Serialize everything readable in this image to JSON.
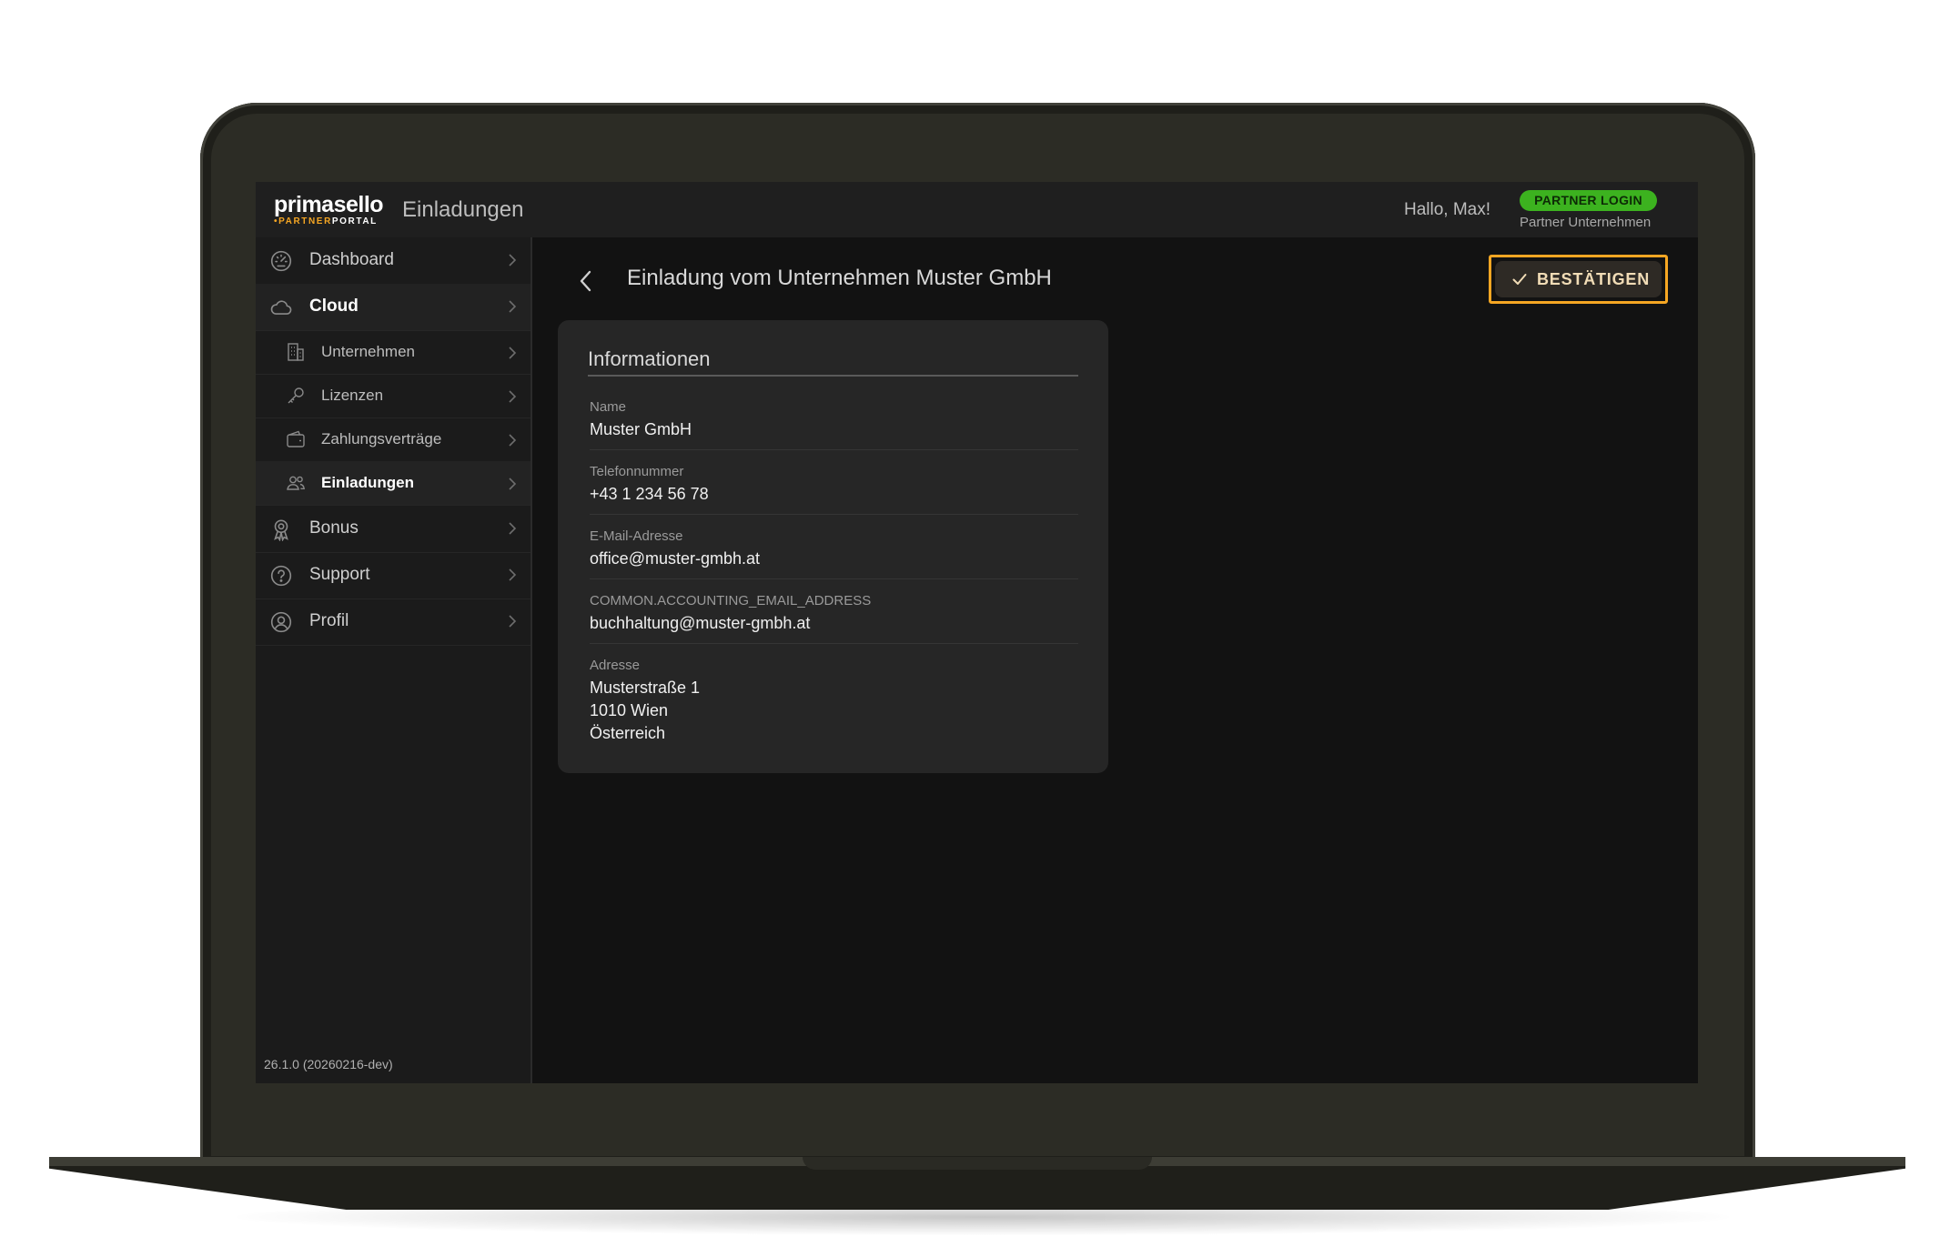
{
  "app": {
    "logo_main": "primasello",
    "logo_sub_dot": "•",
    "logo_sub_partner": "PARTNER",
    "logo_sub_portal": "PORTAL",
    "page_name": "Einladungen"
  },
  "header": {
    "greeting": "Hallo, Max!",
    "badge": "PARTNER LOGIN",
    "subtitle": "Partner Unternehmen"
  },
  "sidebar": {
    "items": [
      {
        "label": "Dashboard",
        "icon": "speedometer-icon"
      },
      {
        "label": "Cloud",
        "icon": "cloud-icon"
      },
      {
        "label": "Unternehmen",
        "icon": "building-icon"
      },
      {
        "label": "Lizenzen",
        "icon": "key-icon"
      },
      {
        "label": "Zahlungsverträge",
        "icon": "wallet-icon"
      },
      {
        "label": "Einladungen",
        "icon": "users-icon"
      },
      {
        "label": "Bonus",
        "icon": "award-icon"
      },
      {
        "label": "Support",
        "icon": "help-icon"
      },
      {
        "label": "Profil",
        "icon": "user-circle-icon"
      }
    ],
    "version": "26.1.0 (20260216-dev)"
  },
  "main": {
    "title": "Einladung vom Unternehmen Muster GmbH",
    "confirm_label": "BESTÄTIGEN",
    "highlight_color": "#f5a623",
    "card": {
      "title": "Informationen",
      "fields": [
        {
          "label": "Name",
          "lines": [
            "Muster GmbH"
          ]
        },
        {
          "label": "Telefonnummer",
          "lines": [
            "+43 1 234 56 78"
          ]
        },
        {
          "label": "E-Mail-Adresse",
          "lines": [
            "office@muster-gmbh.at"
          ]
        },
        {
          "label": "COMMON.ACCOUNTING_EMAIL_ADDRESS",
          "lines": [
            "buchhaltung@muster-gmbh.at"
          ]
        },
        {
          "label": "Adresse",
          "lines": [
            "Musterstraße 1",
            "1010 Wien",
            "Österreich"
          ]
        }
      ]
    }
  },
  "colors": {
    "badge_green": "#3cb21f",
    "accent_orange": "#f5a623"
  }
}
